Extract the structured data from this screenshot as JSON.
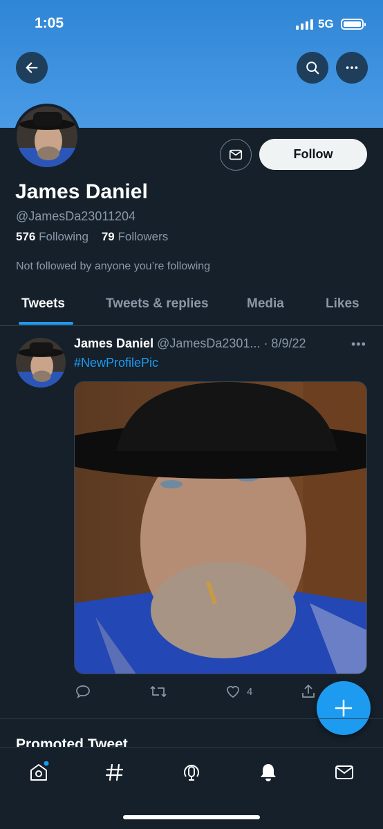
{
  "status": {
    "time": "1:05",
    "network": "5G"
  },
  "profile": {
    "name": "James Daniel",
    "handle": "@JamesDa23011204",
    "following_count": "576",
    "following_label": "Following",
    "followers_count": "79",
    "followers_label": "Followers",
    "not_followed_text": "Not followed by anyone you’re following",
    "follow_label": "Follow"
  },
  "tabs": [
    {
      "label": "Tweets",
      "active": true
    },
    {
      "label": "Tweets & replies",
      "active": false
    },
    {
      "label": "Media",
      "active": false
    },
    {
      "label": "Likes",
      "active": false
    }
  ],
  "tweet": {
    "author": "James Daniel",
    "handle_time": "@JamesDa2301... · 8/9/22",
    "more": "•••",
    "text": "#NewProfilePic",
    "like_count": "4"
  },
  "promoted_label": "Promoted Tweet",
  "colors": {
    "accent": "#1d9bf0",
    "background": "#15202b",
    "banner": "#4a9be6"
  },
  "icons": {
    "nav": [
      "home-icon",
      "explore-hashtag-icon",
      "spaces-icon",
      "notifications-bell-icon",
      "messages-icon"
    ],
    "tweet_actions": [
      "reply-icon",
      "retweet-icon",
      "like-icon",
      "share-icon"
    ]
  }
}
